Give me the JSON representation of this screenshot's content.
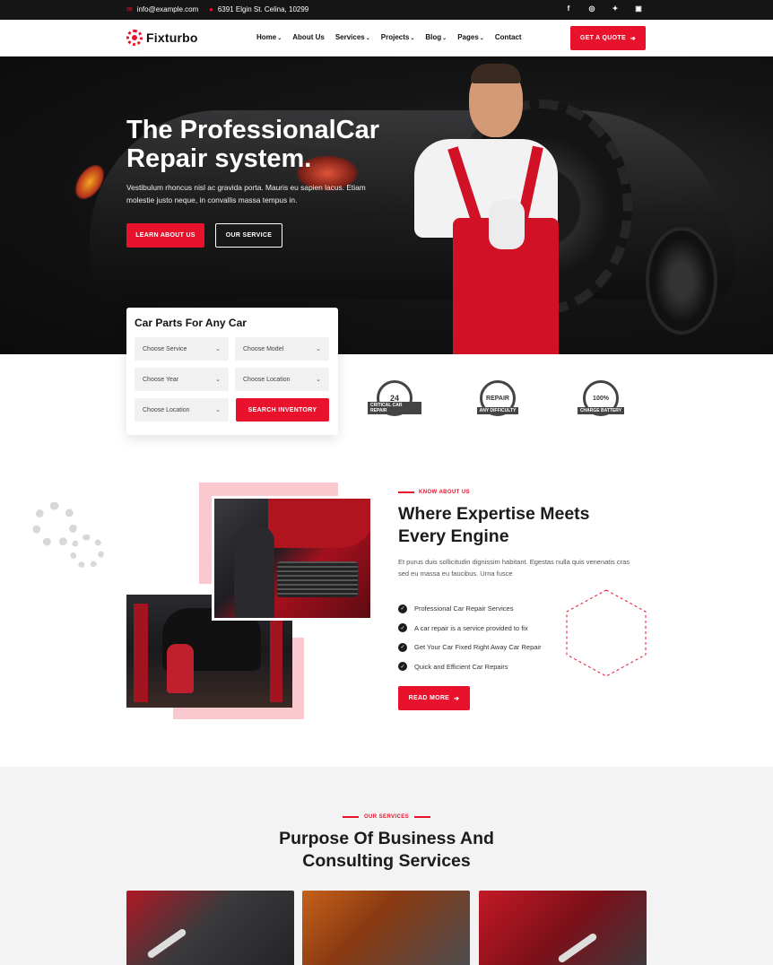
{
  "topbar": {
    "email": "info@example.com",
    "address": "6391 Elgin St. Celina, 10299",
    "social_icons": [
      "facebook-icon",
      "instagram-icon",
      "twitter-icon",
      "linkedin-icon"
    ]
  },
  "header": {
    "brand": "Fixturbo",
    "nav": [
      {
        "label": "Home",
        "dropdown": true
      },
      {
        "label": "About Us",
        "dropdown": false
      },
      {
        "label": "Services",
        "dropdown": true
      },
      {
        "label": "Projects",
        "dropdown": true
      },
      {
        "label": "Blog",
        "dropdown": true
      },
      {
        "label": "Pages",
        "dropdown": true
      },
      {
        "label": "Contact",
        "dropdown": false
      }
    ],
    "quote_label": "GET A QUOTE"
  },
  "hero": {
    "title": "The ProfessionalCar Repair system.",
    "subtitle": "Vestibulum rhoncus nisl ac gravida porta. Mauris eu sapien lacus. Etiam molestie justo neque, in convallis massa tempus in.",
    "learn_label": "LEARN ABOUT US",
    "service_label": "OUR SERVICE"
  },
  "parts_form": {
    "title": "Car Parts For Any Car",
    "service": "Choose Service",
    "model": "Choose Model",
    "year": "Choose Year",
    "location1": "Choose Location",
    "location2": "Choose Location",
    "search_label": "SEARCH INVENTORY"
  },
  "badges": {
    "badge1_text": "24",
    "badge1_ribbon": "CRITICAL CAR REPAIR",
    "badge2_text": "REPAIR",
    "badge2_ribbon": "ANY DIFFICULTY",
    "badge3_text": "100%",
    "badge3_ribbon": "CHARGE BATTERY"
  },
  "about": {
    "eyebrow": "KNOW ABOUT US",
    "title": "Where Expertise Meets Every Engine",
    "description": "Et purus duis sollicitudin dignissim habitant. Egestas nulla quis venenatis cras sed eu massa eu faucibus. Urna fusce",
    "checks": [
      "Professional Car Repair Services",
      "A car repair is a service provided to fix",
      "Get Your Car Fixed Right Away Car Repair",
      "Quick and Efficient Car Repairs"
    ],
    "read_more_label": "READ MORE"
  },
  "services": {
    "eyebrow": "OUR SERVICES",
    "title": "Purpose Of Business And Consulting Services"
  },
  "colors": {
    "accent": "#e8122d",
    "dark": "#151515",
    "section_bg": "#f3f3f3"
  }
}
